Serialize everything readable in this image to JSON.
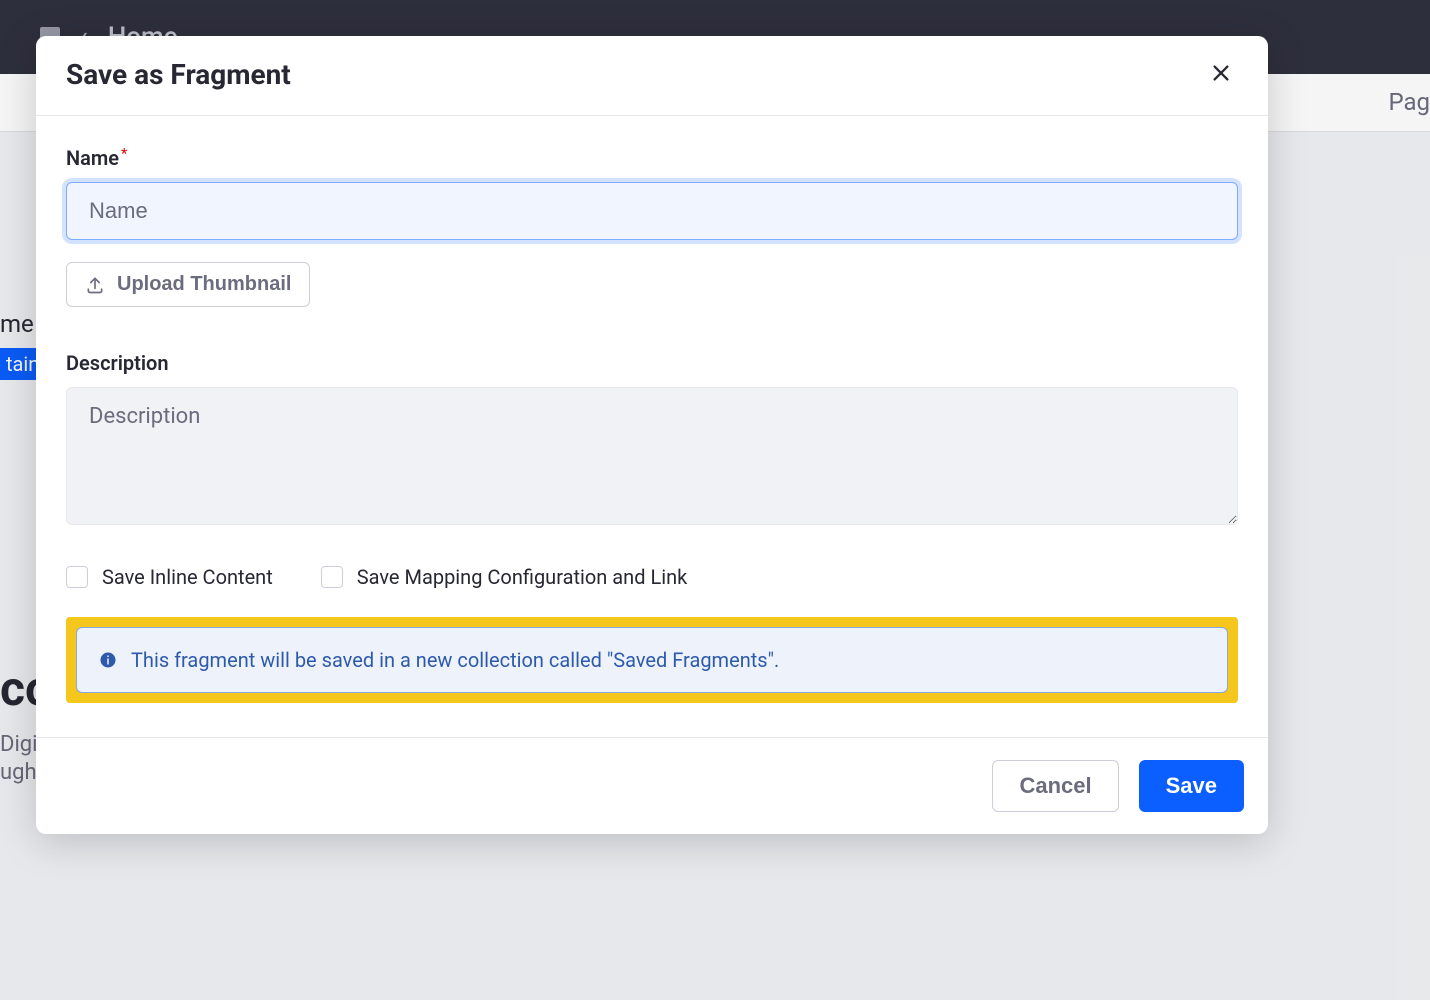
{
  "background": {
    "home": "Home",
    "right_label": "Pag",
    "me": "me",
    "tain": "tain",
    "welcome": "co",
    "sub1": "Digit",
    "sub2": "ugh"
  },
  "modal": {
    "title": "Save as Fragment",
    "name_label": "Name",
    "name_placeholder": "Name",
    "name_value": "",
    "upload_label": "Upload Thumbnail",
    "description_label": "Description",
    "description_placeholder": "Description",
    "description_value": "",
    "checkbox1": "Save Inline Content",
    "checkbox2": "Save Mapping Configuration and Link",
    "info_text": "This fragment will be saved in a new collection called \"Saved Fragments\".",
    "cancel": "Cancel",
    "save": "Save"
  }
}
